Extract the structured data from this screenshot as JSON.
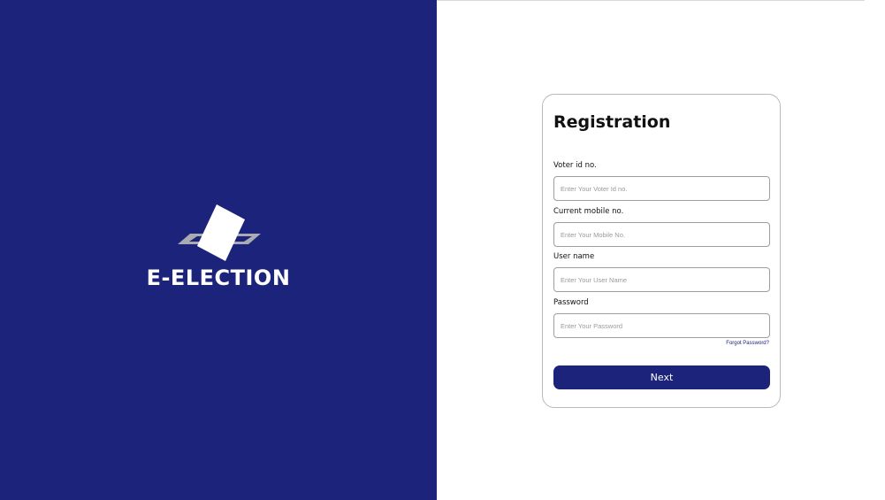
{
  "brand": {
    "name": "E-ELECTION",
    "logo_icon": "ballot-box-icon"
  },
  "registration": {
    "title": "Registration",
    "fields": [
      {
        "label": "Voter id no.",
        "placeholder": "Enter Your Voter Id no.",
        "value": ""
      },
      {
        "label": "Current mobile no.",
        "placeholder": "Enter Your Mobile No.",
        "value": ""
      },
      {
        "label": "User name",
        "placeholder": "Enter Your User Name",
        "value": ""
      },
      {
        "label": "Password",
        "placeholder": "Enter Your Password",
        "value": ""
      }
    ],
    "forgot_password": "Forgot Password?",
    "next_label": "Next"
  },
  "colors": {
    "primary": "#1b247a",
    "background": "#ffffff",
    "logo_gray": "#a9aab2"
  }
}
